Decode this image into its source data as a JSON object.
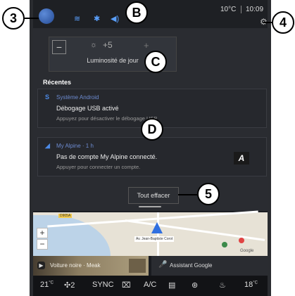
{
  "status_bar": {
    "temperature": "10°C",
    "time": "10:09",
    "icons": [
      "wifi-icon",
      "bluetooth-icon",
      "volume-icon"
    ]
  },
  "brightness": {
    "minus_label": "−",
    "value": "+5",
    "plus_label": "+",
    "label": "Luminosité de jour"
  },
  "notifications": {
    "section_label": "Récentes",
    "items": [
      {
        "source": "Système Android",
        "source_icon": "android-s-icon",
        "title": "Débogage USB activé",
        "subtitle": "Appuyez pour désactiver le débogage USB"
      },
      {
        "source": "My Alpine · 1 h",
        "source_icon": "alpine-icon",
        "title": "Pas de compte My Alpine connecté.",
        "subtitle": "Appuyer pour connecter un compte.",
        "badge": "A"
      }
    ],
    "clear_all_label": "Tout effacer"
  },
  "map": {
    "zoom_in": "+",
    "zoom_out": "−",
    "street_label": "Av. Jean-Baptiste Corot",
    "road_tag": "D905A",
    "attribution": "Google"
  },
  "widgets": {
    "media_title": "Voiture noire · Meak",
    "assistant_label": "Assistant Google"
  },
  "climate": {
    "left_temp": "21",
    "left_unit": "°C",
    "fan_level": "2",
    "sync_label": "SYNC",
    "ac_label": "A/C",
    "right_temp": "18",
    "right_unit": "°C"
  },
  "callouts": [
    "3",
    "B",
    "4",
    "C",
    "D",
    "5"
  ]
}
